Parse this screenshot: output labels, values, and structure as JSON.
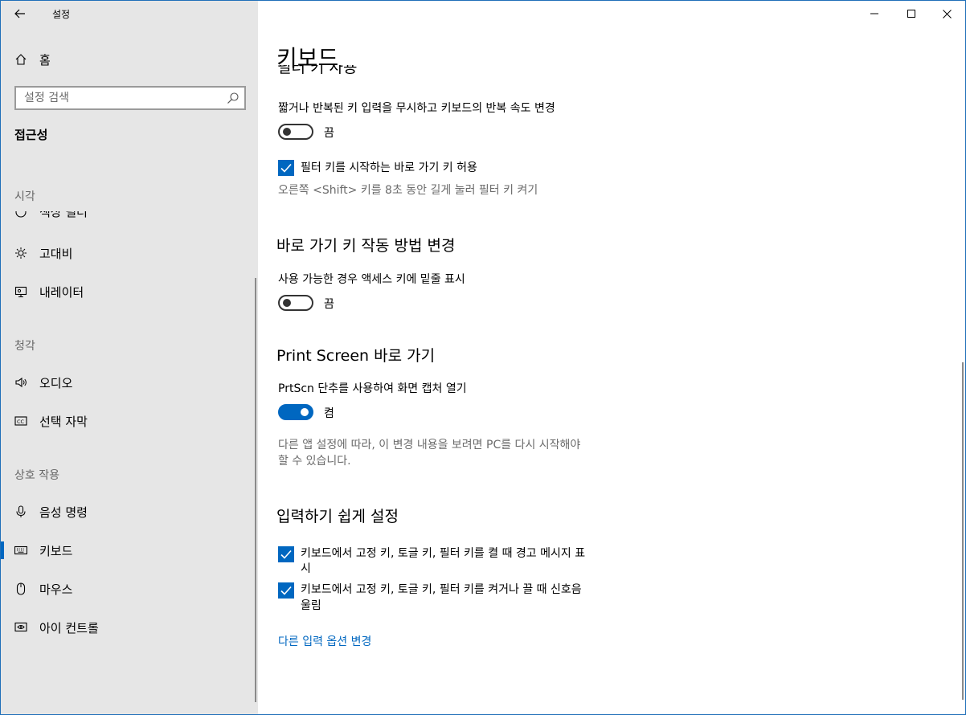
{
  "app": {
    "title": "설정"
  },
  "sidebar": {
    "home_label": "홈",
    "search_placeholder": "설정 검색",
    "section_title": "접근성",
    "groups": {
      "vision": "시각",
      "hearing": "청각",
      "interaction": "상호 작용"
    },
    "cut_item_label": "색상 필터",
    "items": {
      "high_contrast": "고대비",
      "narrator": "내레이터",
      "audio": "오디오",
      "captions": "선택 자막",
      "speech": "음성 명령",
      "keyboard": "키보드",
      "mouse": "마우스",
      "eye_control": "아이 컨트롤"
    },
    "active_item": "keyboard"
  },
  "main": {
    "page_title": "키보드",
    "cut_heading": "필터 키 사용",
    "filter_keys": {
      "description": "짧거나 반복된 키 입력을 무시하고 키보드의 반복 속도 변경",
      "toggle_state": "끔",
      "toggle_on": false,
      "shortcut_checkbox_label": "필터 키를 시작하는 바로 가기 키 허용",
      "shortcut_checked": true,
      "shortcut_hint": "오른쪽 <Shift> 키를 8초 동안 길게 눌러 필터 키 켜기"
    },
    "shortcut_section": {
      "heading": "바로 가기 키 작동 방법 변경",
      "description": "사용 가능한 경우 액세스 키에 밑줄 표시",
      "toggle_state": "끔",
      "toggle_on": false
    },
    "print_screen": {
      "heading": "Print Screen 바로 가기",
      "description": "PrtScn 단추를 사용하여 화면 캡처 열기",
      "toggle_state": "켬",
      "toggle_on": true,
      "hint_line1": "다른 앱 설정에 따라, 이 변경 내용을 보려면 PC를 다시 시작해야",
      "hint_line2": "할 수 있습니다."
    },
    "easy_typing": {
      "heading": "입력하기 쉽게 설정",
      "checkbox1_line1": "키보드에서 고정 키, 토글 키, 필터 키를 켤 때 경고 메시지 표",
      "checkbox1_line2": "시",
      "checkbox1_checked": true,
      "checkbox2_line1": "키보드에서 고정 키, 토글 키, 필터 키를 켜거나 끌 때 신호음",
      "checkbox2_line2": "울림",
      "checkbox2_checked": true
    },
    "other_link": "다른 입력 옵션 변경"
  },
  "colors": {
    "accent": "#0067c0",
    "sidebar_bg": "#e6e6e6"
  },
  "icons": [
    "back-arrow-icon",
    "home-icon",
    "search-icon",
    "color-filter-icon",
    "brightness-icon",
    "narrator-icon",
    "speaker-icon",
    "captions-icon",
    "microphone-icon",
    "keyboard-icon",
    "mouse-icon",
    "eye-control-icon",
    "minimize-icon",
    "maximize-icon",
    "close-icon",
    "checkmark-icon"
  ]
}
